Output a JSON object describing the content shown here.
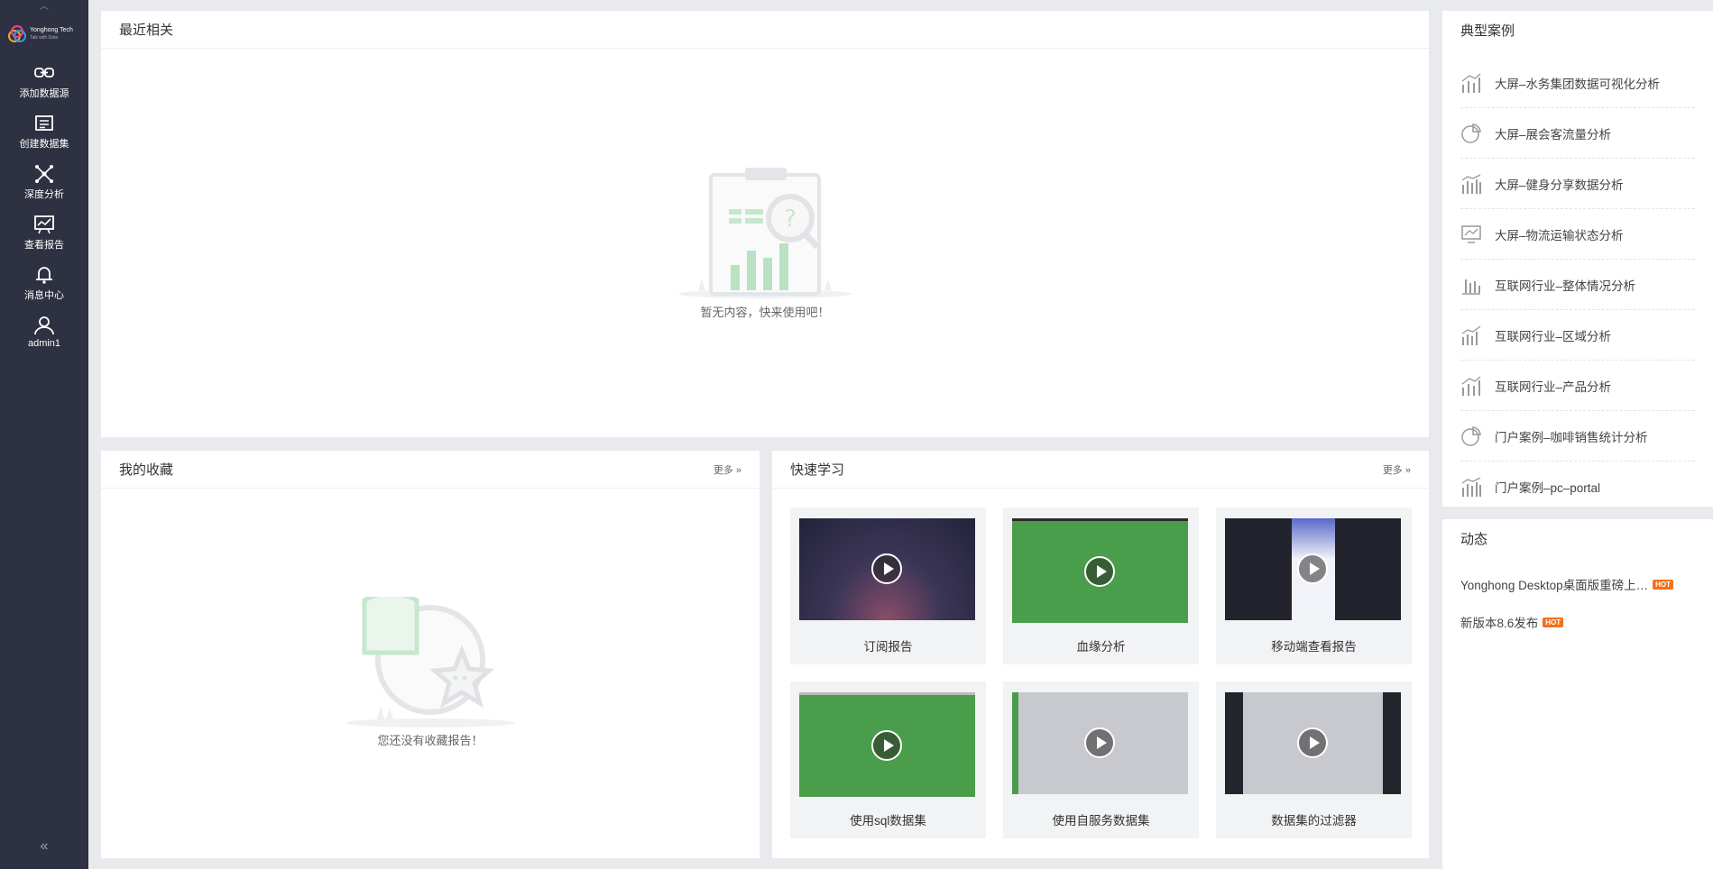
{
  "sidebar": {
    "logo": {
      "name": "Yonghong Tech",
      "tagline": "Talk with Data"
    },
    "items": [
      {
        "label": "添加数据源",
        "icon": "link-icon"
      },
      {
        "label": "创建数据集",
        "icon": "dataset-icon"
      },
      {
        "label": "深度分析",
        "icon": "analysis-icon"
      },
      {
        "label": "查看报告",
        "icon": "report-icon"
      },
      {
        "label": "消息中心",
        "icon": "bell-icon"
      },
      {
        "label": "admin1",
        "icon": "user-icon"
      }
    ],
    "collapse_label": "«"
  },
  "recent": {
    "title": "最近相关",
    "empty_text": "暂无内容，快来使用吧！"
  },
  "favorites": {
    "title": "我的收藏",
    "more": "更多",
    "empty_text": "您还没有收藏报告！"
  },
  "learning": {
    "title": "快速学习",
    "more": "更多",
    "videos": [
      {
        "label": "订阅报告",
        "theme": "dark"
      },
      {
        "label": "血缘分析",
        "theme": "green"
      },
      {
        "label": "移动端查看报告",
        "theme": "mobile"
      },
      {
        "label": "使用sql数据集",
        "theme": "green"
      },
      {
        "label": "使用自服务数据集",
        "theme": "light"
      },
      {
        "label": "数据集的过滤器",
        "theme": "light-dark"
      }
    ]
  },
  "cases": {
    "title": "典型案例",
    "items": [
      {
        "label": "大屏–水务集团数据可视化分析",
        "icon": "bar-trend-icon"
      },
      {
        "label": "大屏–展会客流量分析",
        "icon": "pie-icon"
      },
      {
        "label": "大屏–健身分享数据分析",
        "icon": "bar-line-icon"
      },
      {
        "label": "大屏–物流运输状态分析",
        "icon": "monitor-chart-icon"
      },
      {
        "label": "互联网行业–整体情况分析",
        "icon": "bar-icon"
      },
      {
        "label": "互联网行业–区域分析",
        "icon": "bar-line-icon"
      },
      {
        "label": "互联网行业–产品分析",
        "icon": "bar-trend-icon"
      },
      {
        "label": "门户案例–咖啡销售统计分析",
        "icon": "pie-icon"
      },
      {
        "label": "门户案例–pc–portal",
        "icon": "bar-line-icon"
      }
    ]
  },
  "news": {
    "title": "动态",
    "items": [
      {
        "label": "Yonghong Desktop桌面版重磅上…",
        "badge": "HOT"
      },
      {
        "label": "新版本8.6发布",
        "badge": "HOT"
      }
    ]
  },
  "colors": {
    "sidebar": "#2e3141",
    "accent_green": "#4a9d4a",
    "hot": "#f2711c"
  }
}
